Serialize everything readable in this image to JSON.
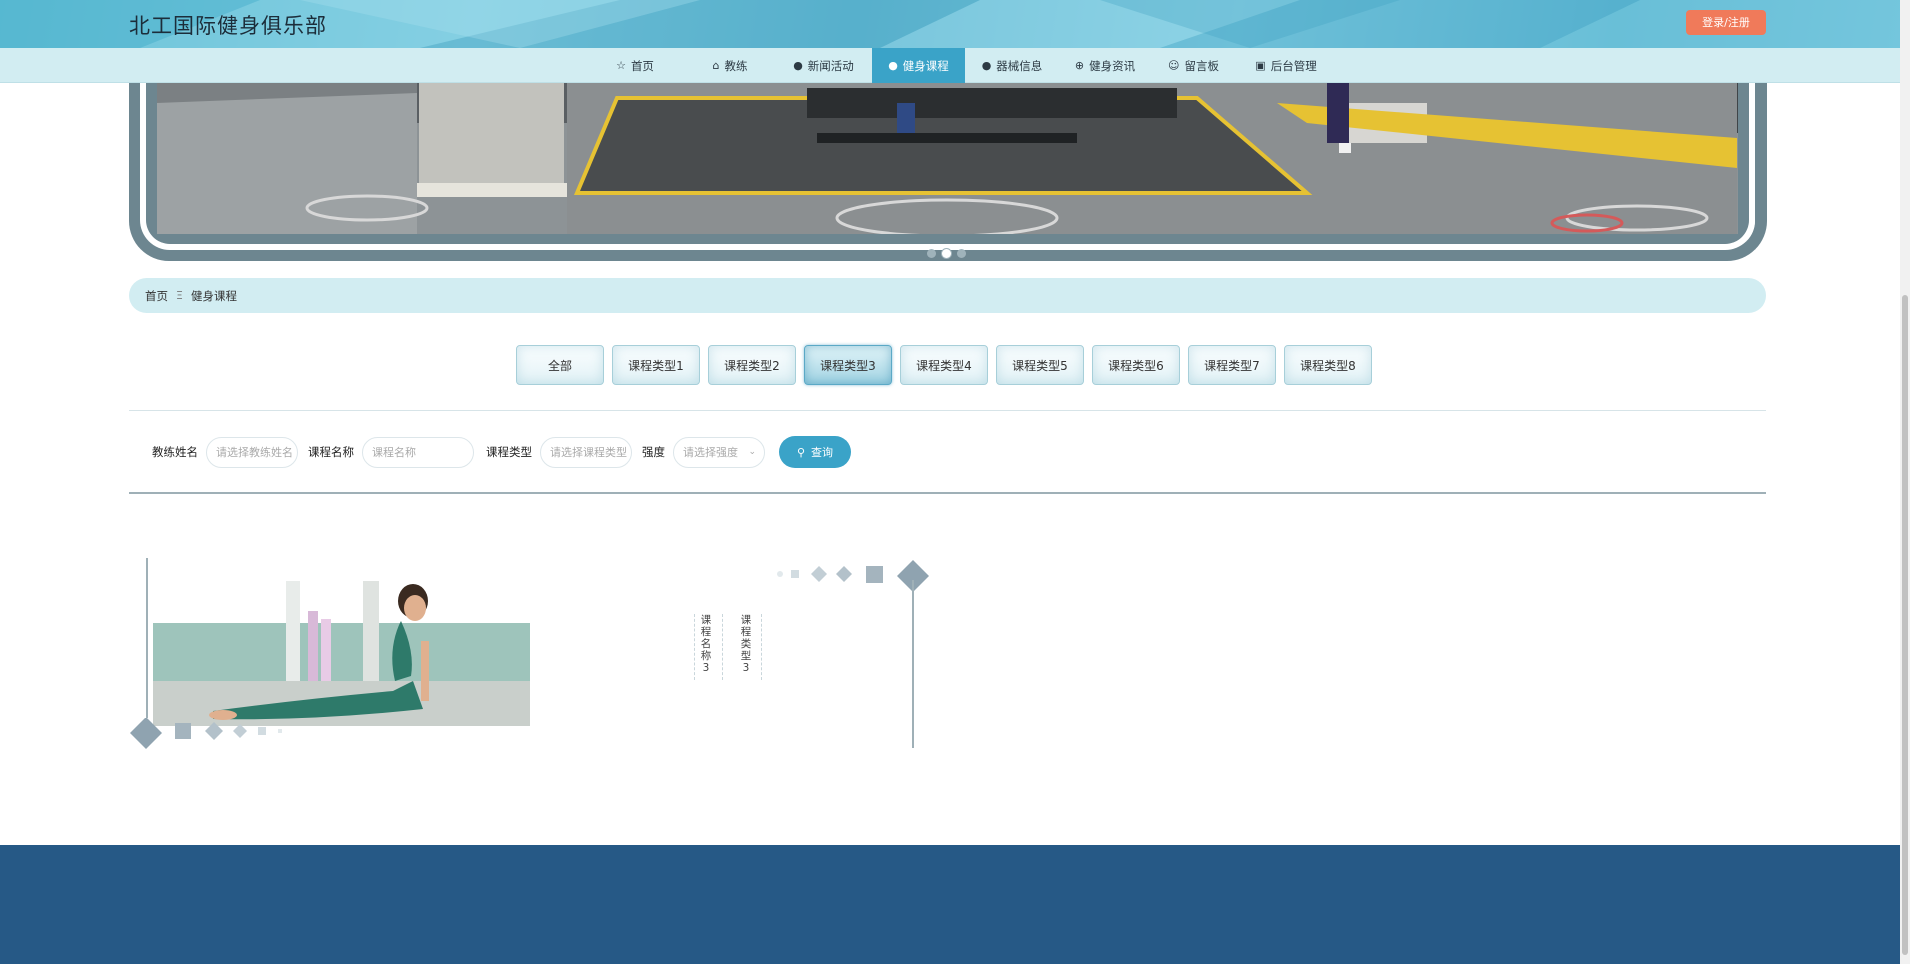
{
  "header": {
    "site_title": "北工国际健身俱乐部",
    "login_label": "登录/注册"
  },
  "nav": {
    "items": [
      {
        "label": "首页",
        "icon": "star-icon"
      },
      {
        "label": "教练",
        "icon": "home-icon"
      },
      {
        "label": "新闻活动",
        "icon": "info-icon"
      },
      {
        "label": "健身课程",
        "icon": "question-icon",
        "active": true
      },
      {
        "label": "器械信息",
        "icon": "info-icon"
      },
      {
        "label": "健身资讯",
        "icon": "globe-icon"
      },
      {
        "label": "留言板",
        "icon": "smile-icon"
      },
      {
        "label": "后台管理",
        "icon": "briefcase-icon"
      }
    ]
  },
  "banner": {
    "slide_count": 3,
    "active_slide": 2
  },
  "breadcrumb": {
    "home": "首页",
    "separator": "Ξ",
    "current": "健身课程"
  },
  "categories": {
    "items": [
      "全部",
      "课程类型1",
      "课程类型2",
      "课程类型3",
      "课程类型4",
      "课程类型5",
      "课程类型6",
      "课程类型7",
      "课程类型8"
    ],
    "active_index": 3
  },
  "search": {
    "coach_label": "教练姓名",
    "coach_placeholder": "请选择教练姓名",
    "course_label": "课程名称",
    "course_placeholder": "课程名称",
    "type_label": "课程类型",
    "type_placeholder": "请选择课程类型",
    "intensity_label": "强度",
    "intensity_placeholder": "请选择强度",
    "button_label": "查询"
  },
  "course_card": {
    "name": "课程名称3",
    "type": "课程类型3"
  },
  "colors": {
    "accent": "#3aa3c8",
    "nav_bg": "#d2edf2",
    "login_btn": "#f07a5a",
    "footer": "#265986",
    "frame": "#6d8690"
  }
}
